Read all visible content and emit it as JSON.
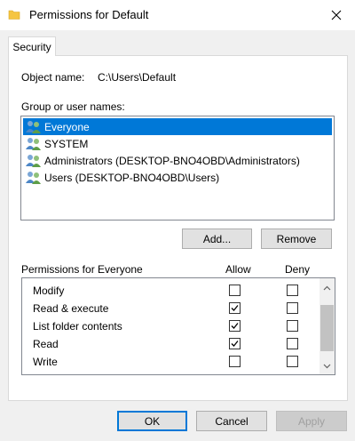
{
  "window": {
    "title": "Permissions for Default",
    "close_icon": "close-icon"
  },
  "tabs": [
    {
      "label": "Security",
      "selected": true
    }
  ],
  "object": {
    "label": "Object name:",
    "value": "C:\\Users\\Default"
  },
  "groups": {
    "label": "Group or user names:",
    "items": [
      {
        "label": "Everyone",
        "selected": true
      },
      {
        "label": "SYSTEM",
        "selected": false
      },
      {
        "label": "Administrators (DESKTOP-BNO4OBD\\Administrators)",
        "selected": false
      },
      {
        "label": "Users (DESKTOP-BNO4OBD\\Users)",
        "selected": false
      }
    ]
  },
  "buttons": {
    "add": "Add...",
    "remove": "Remove",
    "ok": "OK",
    "cancel": "Cancel",
    "apply": "Apply"
  },
  "permissions": {
    "label": "Permissions for Everyone",
    "allow_header": "Allow",
    "deny_header": "Deny",
    "rows": [
      {
        "name": "Modify",
        "allow": false,
        "deny": false
      },
      {
        "name": "Read & execute",
        "allow": true,
        "deny": false
      },
      {
        "name": "List folder contents",
        "allow": true,
        "deny": false
      },
      {
        "name": "Read",
        "allow": true,
        "deny": false
      },
      {
        "name": "Write",
        "allow": false,
        "deny": false
      }
    ]
  },
  "colors": {
    "selection": "#0078d7",
    "accent": "#0078d7"
  }
}
